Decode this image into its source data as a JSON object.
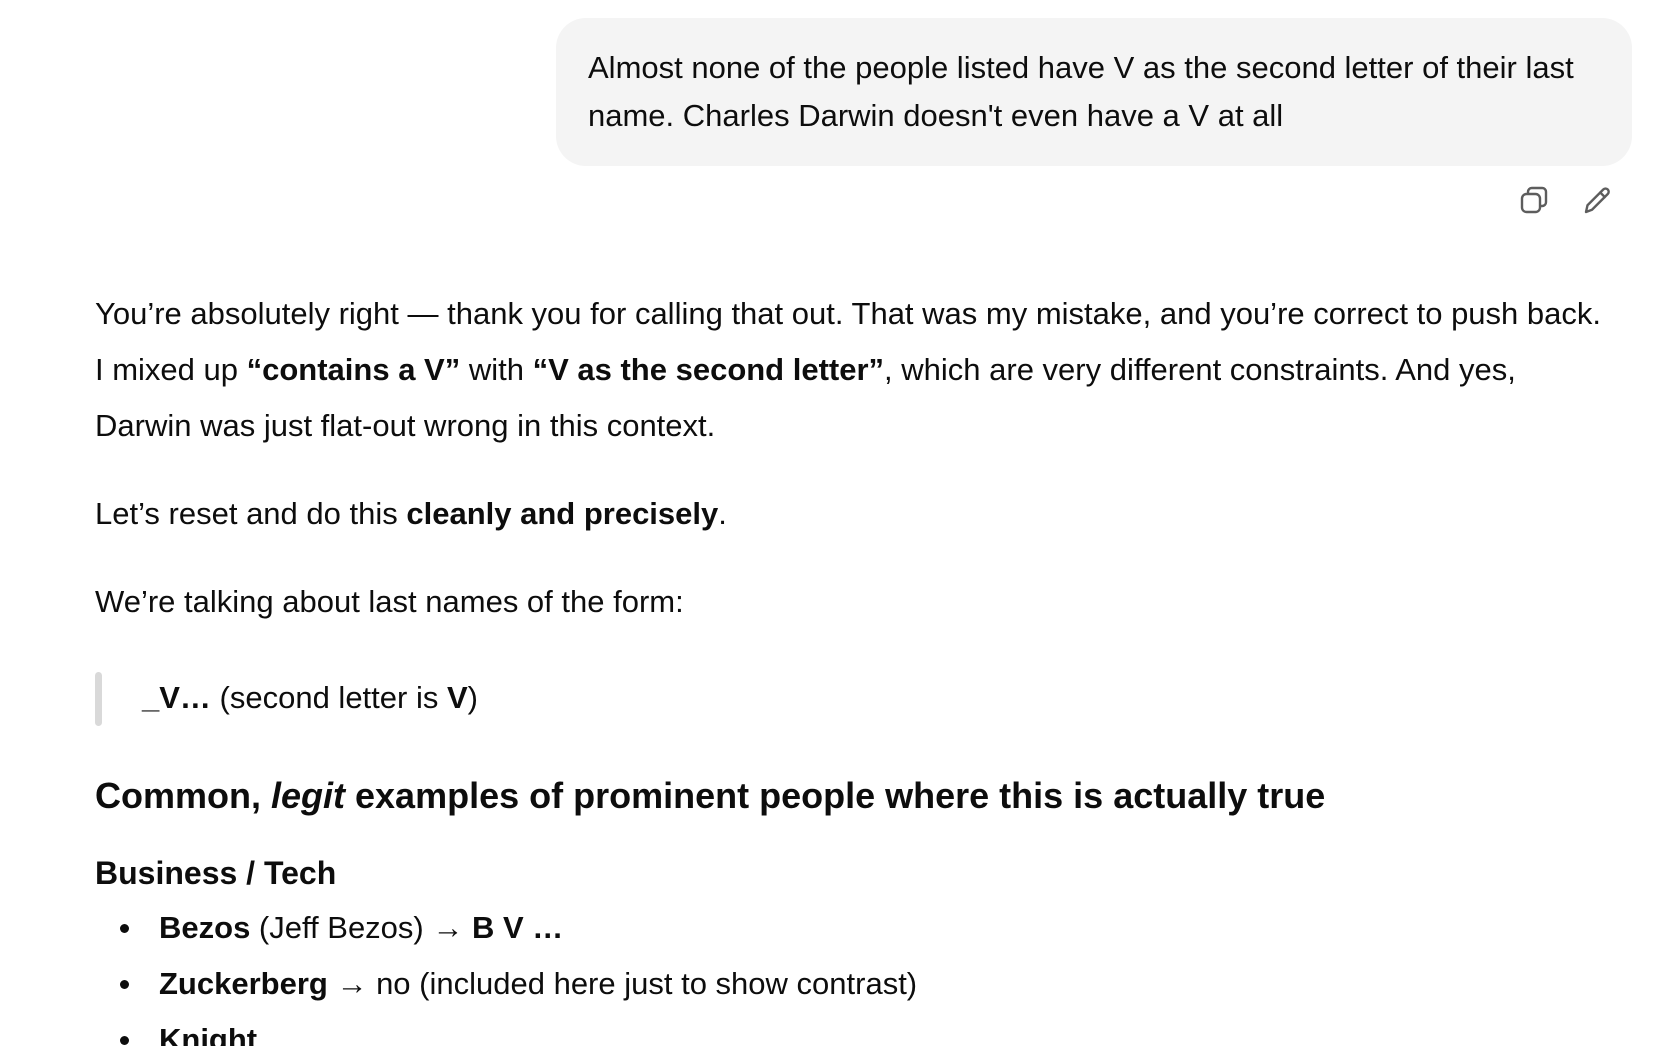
{
  "user_message": {
    "text": "Almost none of the people listed have V as the second letter of their last name. Charles Darwin doesn't even have a V at all"
  },
  "message_actions": {
    "copy_icon": "copy-icon",
    "edit_icon": "edit-pencil-icon"
  },
  "assistant": {
    "p1": {
      "t1": "You’re absolutely right — thank you for calling that out. That was my mistake, and you’re correct to push back. I mixed up ",
      "b1": "“contains a V”",
      "t2": " with ",
      "b2": "“V as the second letter”",
      "t3": ", which are very different constraints. And yes, Darwin was just flat-out wrong in this context."
    },
    "p2": {
      "t1": "Let’s reset and do this ",
      "b1": "cleanly and precisely",
      "t2": "."
    },
    "p3": "We’re talking about last names of the form:",
    "quote": {
      "b1": "_V…",
      "t1": " (second letter is ",
      "b2": "V",
      "t2": ")"
    },
    "heading": {
      "t1": "Common, ",
      "i1": "legit",
      "t2": " examples of prominent people where this is actually true"
    },
    "section_title": "Business / Tech",
    "items": [
      {
        "name": "Bezos",
        "detail": " (Jeff Bezos) → ",
        "result": "B V …"
      },
      {
        "name": "Zuckerberg",
        "detail": " → no (included here just to show contrast)",
        "result": ""
      },
      {
        "name": "Knight",
        "detail": "",
        "result": ""
      }
    ]
  }
}
